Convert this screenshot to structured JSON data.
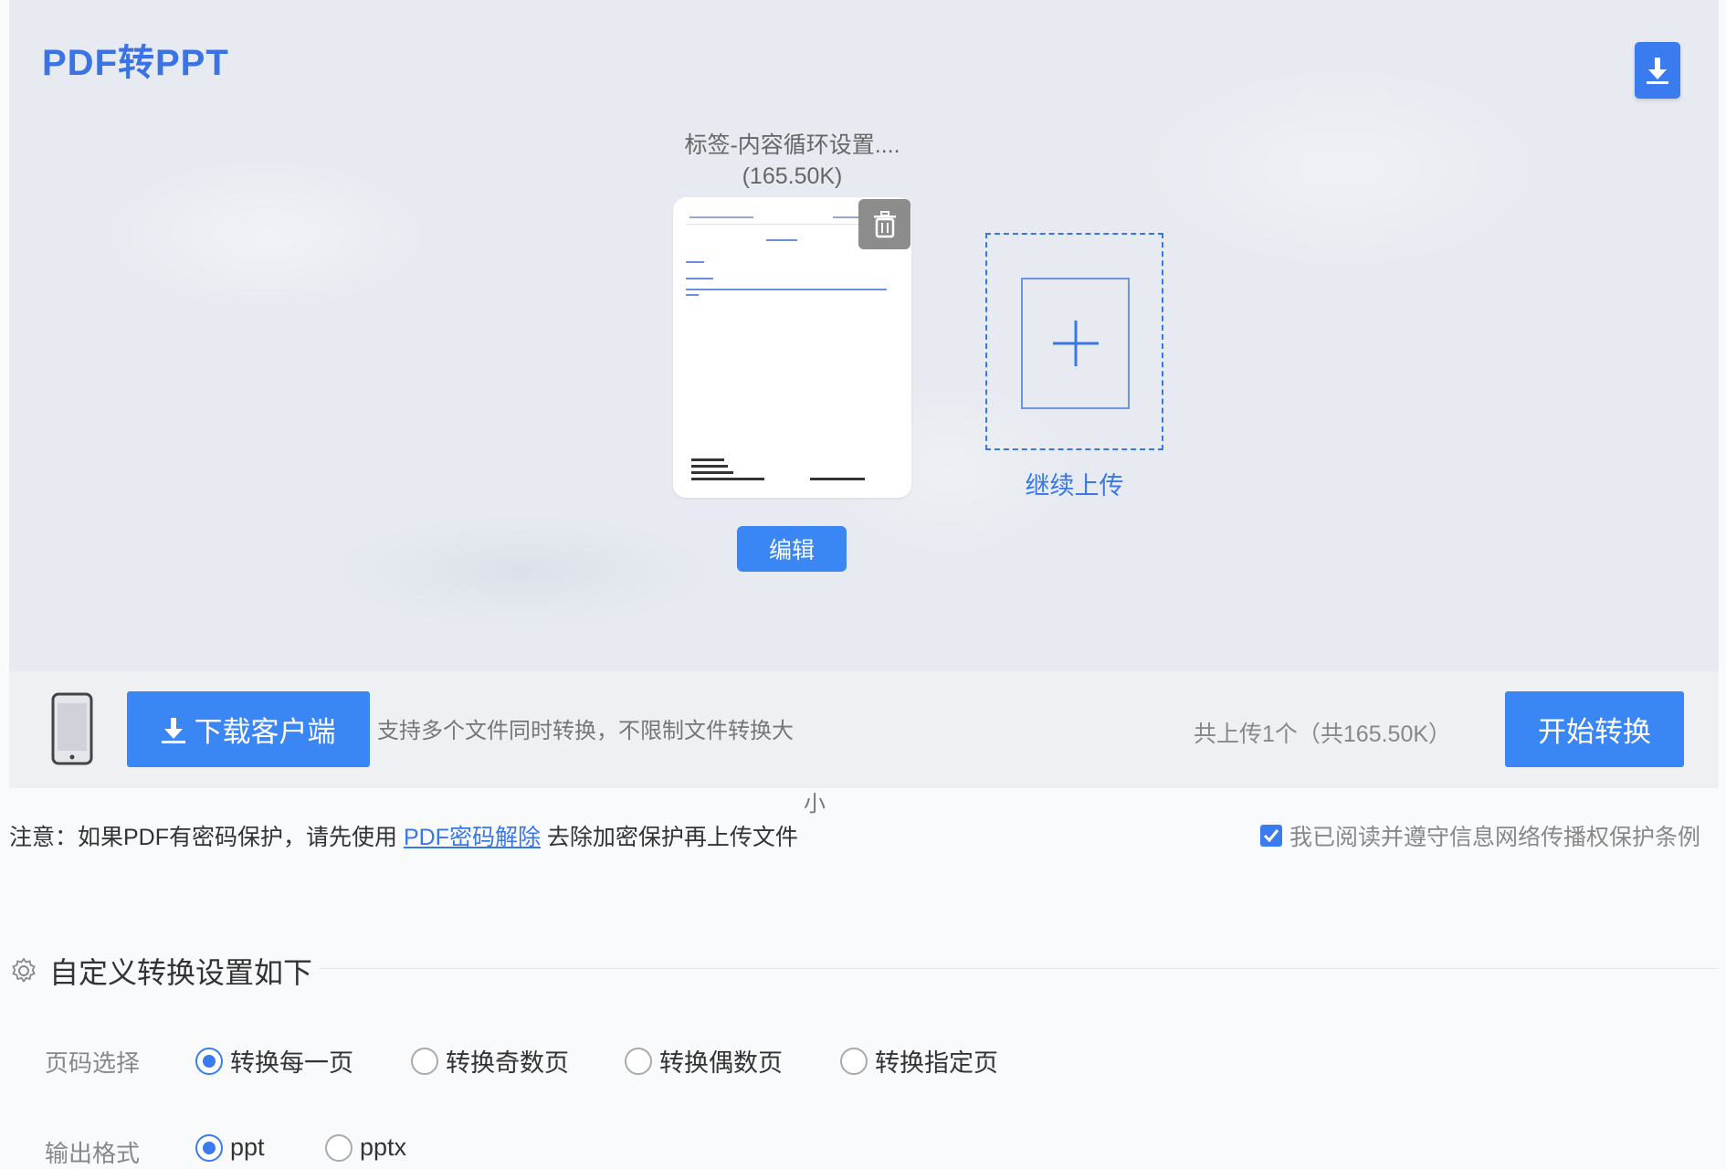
{
  "header": {
    "title": "PDF转PPT"
  },
  "file": {
    "name": "标签-内容循环设置....",
    "size": "(165.50K)",
    "edit_label": "编辑"
  },
  "upload": {
    "continue_label": "继续上传"
  },
  "toolbar": {
    "client_button": "下载客户端",
    "support_text": "支持多个文件同时转换，不限制文件转换大",
    "support_text_wrap": "小",
    "upload_count": "共上传1个（共165.50K）",
    "start_button": "开始转换"
  },
  "notice": {
    "prefix": "注意：如果PDF有密码保护，请先使用 ",
    "link": "PDF密码解除",
    "suffix": " 去除加密保护再上传文件"
  },
  "agreement": {
    "label": "我已阅读并遵守信息网络传播权保护条例",
    "checked": true
  },
  "settings": {
    "title": "自定义转换设置如下",
    "page_selection": {
      "label": "页码选择",
      "options": [
        "转换每一页",
        "转换奇数页",
        "转换偶数页",
        "转换指定页"
      ],
      "selected": "转换每一页"
    },
    "output_format": {
      "label": "输出格式",
      "options": [
        "ppt",
        "pptx"
      ],
      "selected": "ppt"
    }
  },
  "colors": {
    "accent": "#3a7cf0",
    "title": "#3973e6"
  }
}
